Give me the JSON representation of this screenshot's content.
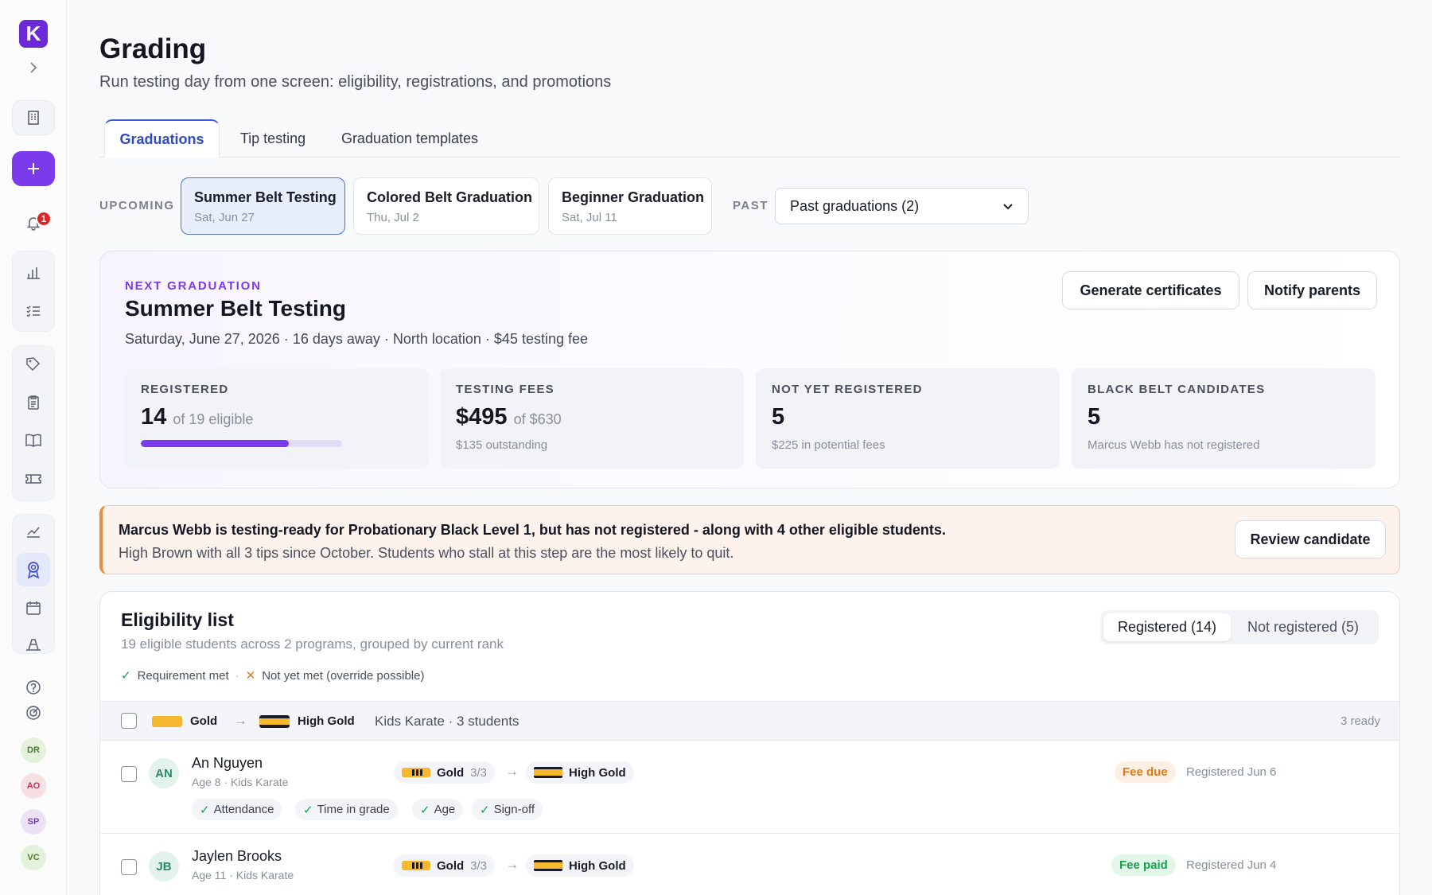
{
  "app": {
    "logo_letter": "K",
    "notification_count": "1"
  },
  "sidebar": {
    "avatars": [
      {
        "initials": "DR",
        "bg": "#e4f1dc",
        "fg": "#4d7c2f"
      },
      {
        "initials": "AO",
        "bg": "#f6e0e4",
        "fg": "#b03a55"
      },
      {
        "initials": "SP",
        "bg": "#ece2f5",
        "fg": "#7a3fa6"
      },
      {
        "initials": "VC",
        "bg": "#e4f1dc",
        "fg": "#4d7c2f"
      }
    ]
  },
  "page": {
    "title": "Grading",
    "subtitle": "Run testing day from one screen: eligibility, registrations, and promotions"
  },
  "tabs": [
    {
      "label": "Graduations",
      "active": true
    },
    {
      "label": "Tip testing",
      "active": false
    },
    {
      "label": "Graduation templates",
      "active": false
    }
  ],
  "upcoming": {
    "label": "UPCOMING",
    "cards": [
      {
        "name": "Summer Belt Testing",
        "date": "Sat, Jun 27"
      },
      {
        "name": "Colored Belt Graduation",
        "date": "Thu, Jul 2"
      },
      {
        "name": "Beginner Graduation",
        "date": "Sat, Jul 11"
      }
    ]
  },
  "past": {
    "label": "PAST",
    "selected": "Past graduations (2)"
  },
  "next": {
    "label": "NEXT GRADUATION",
    "title": "Summer Belt Testing",
    "meta": "Saturday, June 27, 2026 · 16 days away · North location · $45 testing fee",
    "generate_label": "Generate certificates",
    "notify_label": "Notify parents",
    "stats": [
      {
        "label": "REGISTERED",
        "value": "14",
        "of": "of 19 eligible",
        "progress": 0.7368
      },
      {
        "label": "TESTING FEES",
        "value": "$495",
        "of": "of $630",
        "note": "$135 outstanding"
      },
      {
        "label": "NOT YET REGISTERED",
        "value": "5",
        "note": "$225 in potential fees"
      },
      {
        "label": "BLACK BELT CANDIDATES",
        "value": "5",
        "note": "Marcus Webb has not registered"
      }
    ]
  },
  "alert": {
    "title": "Marcus Webb is testing-ready for Probationary Black Level 1, but has not registered - along with 4 other eligible students.",
    "body": "High Brown with all 3 tips since October. Students who stall at this step are the most likely to quit.",
    "button": "Review candidate"
  },
  "eligibility": {
    "title": "Eligibility list",
    "subtitle": "19 eligible students across 2 programs, grouped by current rank",
    "legend_met": "Requirement met",
    "legend_sep": "·",
    "legend_not": "Not yet met (override possible)",
    "seg_registered": "Registered (14)",
    "seg_not_registered": "Not registered (5)",
    "group": {
      "from": "Gold",
      "to": "High Gold",
      "program": "Kids Karate · 3 students",
      "ready": "3 ready"
    },
    "students": [
      {
        "initials": "AN",
        "name": "An Nguyen",
        "meta": "Age 8 · Kids Karate",
        "from": "Gold",
        "tips": "3/3",
        "to": "High Gold",
        "fee": "Fee due",
        "fee_state": "due",
        "registered": "Registered Jun 6",
        "reqs": [
          "Attendance",
          "Time in grade",
          "Age",
          "Sign-off"
        ]
      },
      {
        "initials": "JB",
        "name": "Jaylen Brooks",
        "meta": "Age 11 · Kids Karate",
        "from": "Gold",
        "tips": "3/3",
        "to": "High Gold",
        "fee": "Fee paid",
        "fee_state": "paid",
        "registered": "Registered Jun 4",
        "reqs": []
      }
    ]
  }
}
